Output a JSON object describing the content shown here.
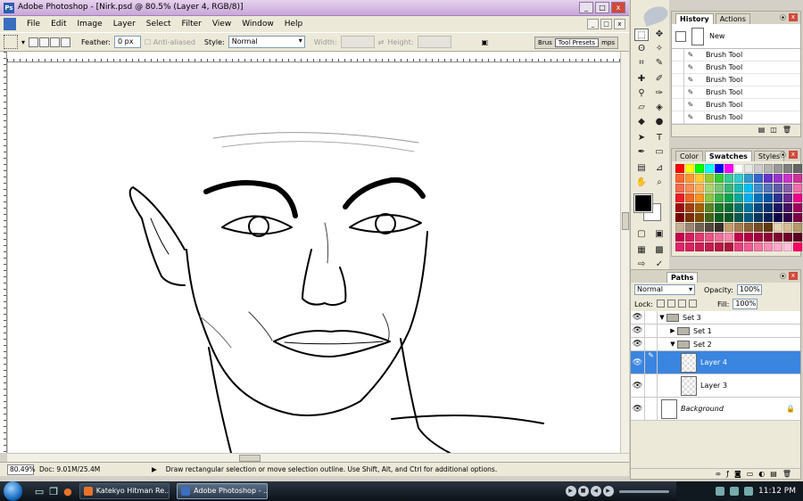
{
  "window": {
    "title": "Adobe Photoshop - [Nirk.psd @ 80.5% (Layer 4, RGB/8)]",
    "logo": "Ps",
    "buttons": [
      "_",
      "□",
      "x"
    ]
  },
  "menu": {
    "items": [
      "File",
      "Edit",
      "Image",
      "Layer",
      "Select",
      "Filter",
      "View",
      "Window",
      "Help"
    ],
    "doc_buttons": [
      "_",
      "□",
      "x"
    ]
  },
  "options": {
    "feather_label": "Feather:",
    "feather_value": "0 px",
    "anti_aliased_label": "Anti-aliased",
    "style_label": "Style:",
    "style_value": "Normal",
    "width_label": "Width:",
    "height_label": "Height:",
    "palette_well": [
      "Brus",
      "Tool Presets",
      "mps"
    ]
  },
  "status": {
    "zoom": "80.49%",
    "doc": "Doc: 9.01M/25.4M",
    "arrow": "▶",
    "hint": "Draw rectangular selection or move selection outline.  Use Shift, Alt, and Ctrl for additional options."
  },
  "history": {
    "tabs": [
      "History",
      "Actions"
    ],
    "snapshot": "New",
    "rows": [
      "Brush Tool",
      "Brush Tool",
      "Brush Tool",
      "Brush Tool",
      "Brush Tool",
      "Brush Tool"
    ]
  },
  "swatches_panel": {
    "tabs": [
      "Color",
      "Swatches",
      "Styles"
    ],
    "colors": [
      "#ff0000",
      "#ffff00",
      "#00ff00",
      "#00ffff",
      "#0000ff",
      "#ff00ff",
      "#ffffff",
      "#e6e6e6",
      "#cccccc",
      "#b3b3b3",
      "#999999",
      "#808080",
      "#666666",
      "#ff6633",
      "#ff9933",
      "#ffcc33",
      "#99cc33",
      "#33cc33",
      "#33cc99",
      "#33cccc",
      "#3399cc",
      "#3366cc",
      "#6633cc",
      "#9933cc",
      "#cc33cc",
      "#cc3399",
      "#f26c4f",
      "#f68e55",
      "#fbaf5c",
      "#acd372",
      "#7cc576",
      "#3bb878",
      "#1abbb4",
      "#00bff3",
      "#438ccb",
      "#5574b9",
      "#605ca8",
      "#855fa8",
      "#f06ea9",
      "#ed1c24",
      "#f26522",
      "#f7941d",
      "#8dc63f",
      "#39b54a",
      "#00a651",
      "#00a99d",
      "#00aeef",
      "#0072bc",
      "#0054a6",
      "#2e3192",
      "#662d91",
      "#ec008c",
      "#9e0b0f",
      "#a0410d",
      "#a3620a",
      "#598527",
      "#197b30",
      "#007236",
      "#00746b",
      "#0076a3",
      "#004a80",
      "#003471",
      "#1b1464",
      "#440e62",
      "#9e005d",
      "#790000",
      "#7b2e00",
      "#7d4900",
      "#406618",
      "#005e20",
      "#005826",
      "#005952",
      "#005b7f",
      "#003663",
      "#002157",
      "#0d004c",
      "#32004b",
      "#7b0046",
      "#c7b299",
      "#998675",
      "#736357",
      "#534741",
      "#37302a",
      "#c69c6d",
      "#a67c52",
      "#8c6239",
      "#754c24",
      "#603913",
      "#e6d2b4",
      "#d4bc94",
      "#b59a6c",
      "#c2004d",
      "#d41e5e",
      "#e23a71",
      "#e95486",
      "#f06e9a",
      "#f589ae",
      "#c3004a",
      "#b30045",
      "#a1003e",
      "#900037",
      "#7e0030",
      "#6d0029",
      "#5b0022",
      "#e0256b",
      "#d92262",
      "#cf1f59",
      "#c41c50",
      "#b91947",
      "#ae163e",
      "#ea3f7f",
      "#f15a92",
      "#f575a5",
      "#f98fb8",
      "#fcaacb",
      "#ffc4dd",
      "#ff0066"
    ]
  },
  "layers": {
    "tabs_visible": "Paths",
    "blend_mode": "Normal",
    "opacity_label": "Opacity:",
    "opacity_value": "100%",
    "lock_label": "Lock:",
    "fill_label": "Fill:",
    "fill_value": "100%",
    "rows": [
      {
        "name": "Set 3",
        "type": "folder",
        "expanded": true
      },
      {
        "name": "Set 1",
        "type": "folder",
        "expanded": false
      },
      {
        "name": "Set 2",
        "type": "folder",
        "expanded": true
      },
      {
        "name": "Layer 4",
        "type": "layer",
        "active": true
      },
      {
        "name": "Layer 3",
        "type": "layer"
      },
      {
        "name": "Background",
        "type": "background",
        "locked": true
      }
    ]
  },
  "taskbar": {
    "tasks": [
      "Katekyo Hitman Re...",
      "Adobe Photoshop - ..."
    ],
    "time": "11:12 PM"
  },
  "icons": {
    "eye": "👁",
    "triangle_open": "▼",
    "triangle_closed": "▶",
    "lock": "🔒"
  }
}
